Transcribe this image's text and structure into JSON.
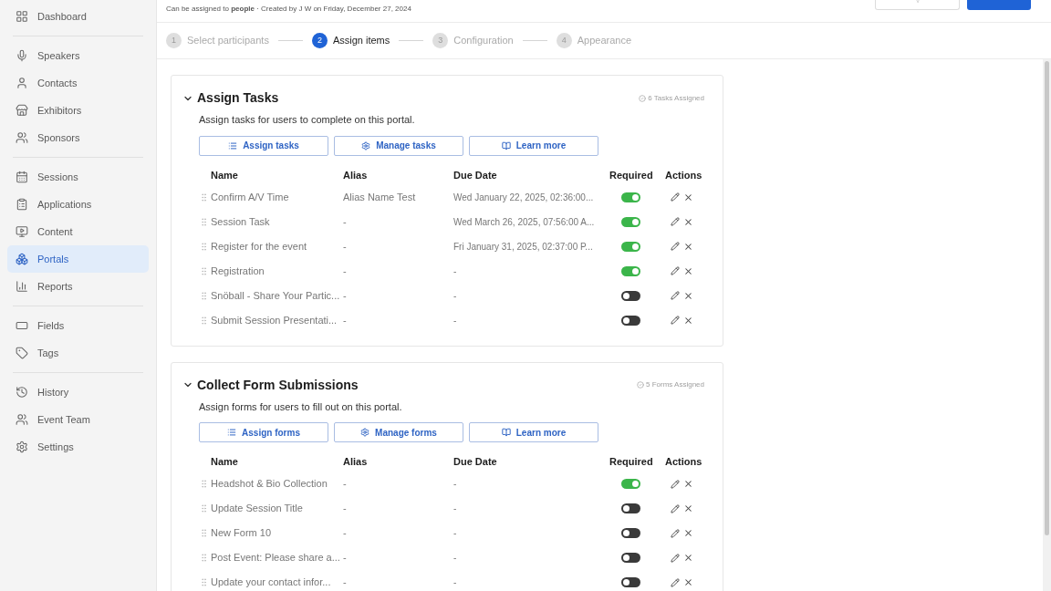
{
  "sidebar": {
    "groups": [
      [
        {
          "label": "Dashboard",
          "selected": false
        }
      ],
      [
        {
          "label": "Speakers",
          "selected": false
        },
        {
          "label": "Contacts",
          "selected": false
        },
        {
          "label": "Exhibitors",
          "selected": false
        },
        {
          "label": "Sponsors",
          "selected": false
        }
      ],
      [
        {
          "label": "Sessions",
          "selected": false
        },
        {
          "label": "Applications",
          "selected": false
        },
        {
          "label": "Content",
          "selected": false
        },
        {
          "label": "Portals",
          "selected": true
        },
        {
          "label": "Reports",
          "selected": false
        }
      ],
      [
        {
          "label": "Fields",
          "selected": false
        },
        {
          "label": "Tags",
          "selected": false
        }
      ],
      [
        {
          "label": "History",
          "selected": false
        },
        {
          "label": "Event Team",
          "selected": false
        },
        {
          "label": "Settings",
          "selected": false
        }
      ]
    ]
  },
  "header": {
    "info": "Can be assigned to **people** · Created by J W on Friday, December 27, 2024"
  },
  "steps": [
    {
      "number": "1",
      "label": "Select participants",
      "selected": false
    },
    {
      "number": "2",
      "label": "Assign items",
      "selected": true
    },
    {
      "number": "3",
      "label": "Configuration",
      "selected": false
    },
    {
      "number": "4",
      "label": "Appearance",
      "selected": false
    }
  ],
  "sections": [
    {
      "title": "Assign Tasks",
      "expanded": true,
      "badge": "6 Tasks Assigned",
      "description": "Assign tasks for users to complete on this portal.",
      "buttons": [
        "Assign tasks",
        "Manage tasks",
        "Learn more"
      ],
      "columns": [
        "Name",
        "Alias",
        "Due Date",
        "Required",
        "Actions"
      ],
      "rows": [
        {
          "name": "Confirm A/V Time",
          "alias": "Alias Name Test",
          "due_date": "Wed January 22, 2025, 02:36:00...",
          "required": true
        },
        {
          "name": "Session Task",
          "alias": "-",
          "due_date": "Wed March 26, 2025, 07:56:00 A...",
          "required": true
        },
        {
          "name": "Register for the event",
          "alias": "-",
          "due_date": "Fri January 31, 2025, 02:37:00 P...",
          "required": true
        },
        {
          "name": "Registration",
          "alias": "-",
          "due_date": "-",
          "required": true
        },
        {
          "name": "Snöball - Share Your Partic...",
          "alias": "-",
          "due_date": "-",
          "required": false
        },
        {
          "name": "Submit Session Presentati...",
          "alias": "-",
          "due_date": "-",
          "required": false
        }
      ]
    },
    {
      "title": "Collect Form Submissions",
      "expanded": true,
      "badge": "5 Forms Assigned",
      "description": "Assign forms for users to fill out on this portal.",
      "buttons": [
        "Assign forms",
        "Manage forms",
        "Learn more"
      ],
      "columns": [
        "Name",
        "Alias",
        "Due Date",
        "Required",
        "Actions"
      ],
      "rows": [
        {
          "name": "Headshot & Bio Collection",
          "alias": "-",
          "due_date": "-",
          "required": true
        },
        {
          "name": "Update Session Title",
          "alias": "-",
          "due_date": "-",
          "required": false
        },
        {
          "name": "New Form 10",
          "alias": "-",
          "due_date": "-",
          "required": false
        },
        {
          "name": "Post Event: Please share a...",
          "alias": "-",
          "due_date": "-",
          "required": false
        },
        {
          "name": "Update your contact infor...",
          "alias": "-",
          "due_date": "-",
          "required": false
        }
      ]
    }
  ]
}
